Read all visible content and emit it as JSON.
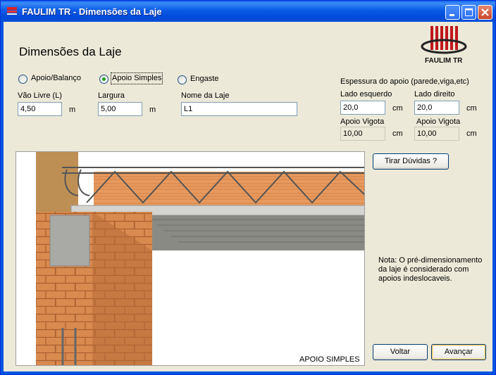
{
  "window": {
    "title": "FAULIM TR - Dimensões da Laje"
  },
  "header": {
    "title": "Dimensões da Laje",
    "logo_text": "FAULIM TR"
  },
  "support_type": {
    "options": [
      "Apoio/Balanço",
      "Apoio Simples",
      "Engaste"
    ],
    "selected": "Apoio Simples"
  },
  "fields": {
    "vao_livre": {
      "label": "Vão Livre (L)",
      "value": "4,50",
      "unit": "m"
    },
    "largura": {
      "label": "Largura",
      "value": "5,00",
      "unit": "m"
    },
    "nome": {
      "label": "Nome da Laje",
      "value": "L1"
    }
  },
  "support_thickness": {
    "title": "Espessura do apoio (parede,viga,etc)",
    "left_label": "Lado esquerdo",
    "right_label": "Lado direito",
    "left_value": "20,0",
    "right_value": "20,0",
    "unit": "cm",
    "vigota_left_label": "Apoio Vigota",
    "vigota_right_label": "Apoio Vigota",
    "vigota_left_value": "10,00",
    "vigota_right_value": "10,00"
  },
  "illustration": {
    "caption": "APOIO SIMPLES"
  },
  "help_button": "Tirar Dúvidas ?",
  "note": "Nota: O pré-dimensionamento da laje é considerado com apoios indeslocaveis.",
  "buttons": {
    "back": "Voltar",
    "next": "Avançar"
  },
  "colors": {
    "titlebar": "#0054e3",
    "dialog_bg": "#ece9d8",
    "logo_red": "#c0171d",
    "brick": "#d98a4f"
  }
}
